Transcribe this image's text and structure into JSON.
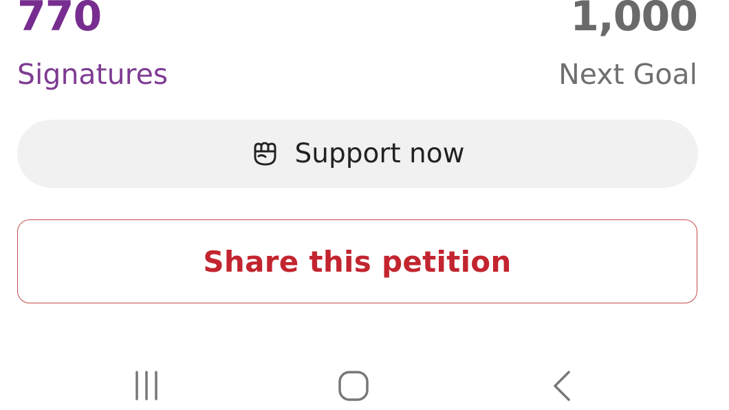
{
  "stats": {
    "signatures_value": "770",
    "signatures_label": "Signatures",
    "goal_value": "1,000",
    "goal_label": "Next Goal"
  },
  "support": {
    "label": "Support now",
    "icon": "fist-icon"
  },
  "share": {
    "label": "Share this petition"
  },
  "navbar": {
    "recents_icon": "recents-icon",
    "home_icon": "home-icon",
    "back_icon": "back-icon"
  },
  "colors": {
    "signatures": "#772d8f",
    "goal": "#6a6a6a",
    "share": "#c2252f",
    "support_bg": "#f1f1f1"
  }
}
